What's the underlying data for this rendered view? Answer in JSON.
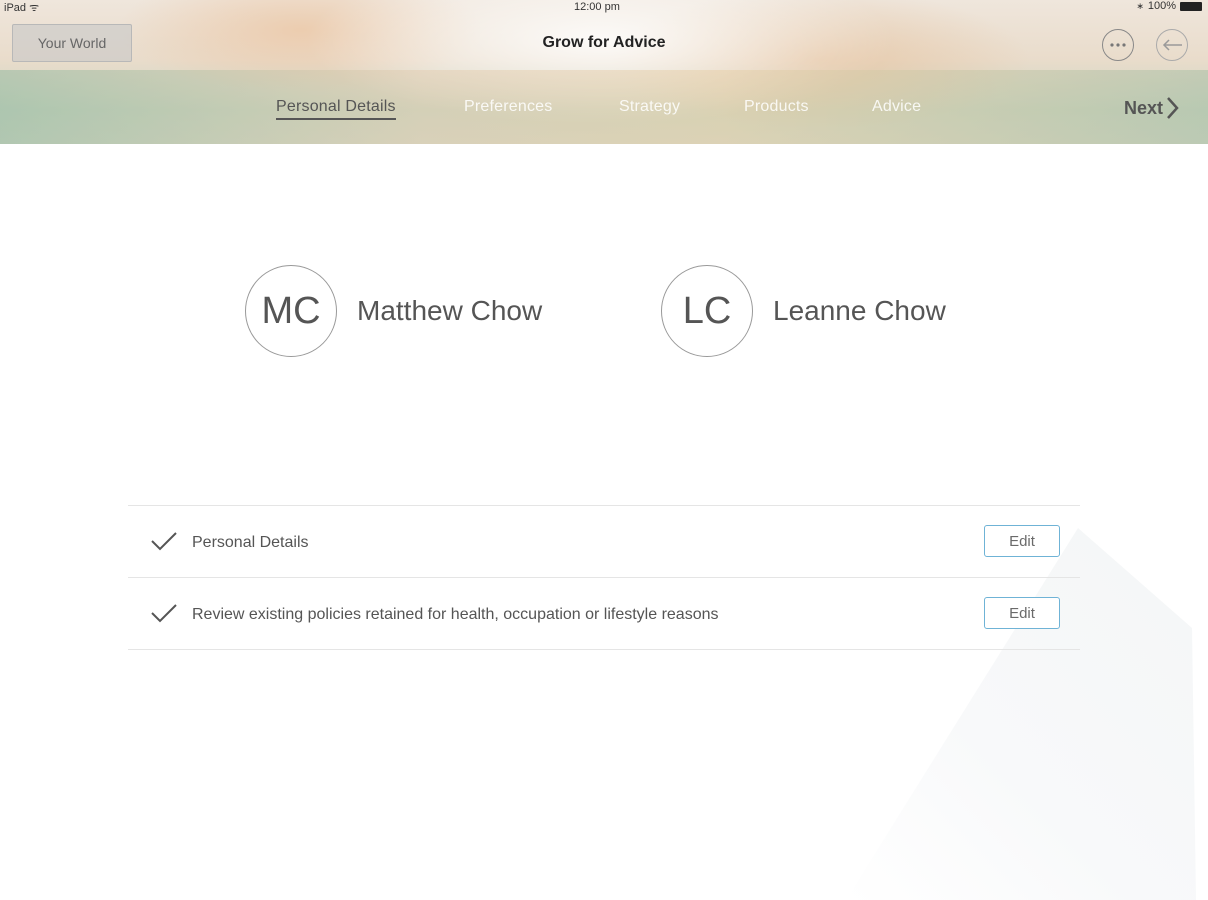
{
  "status_bar": {
    "device": "iPad",
    "time": "12:00 pm",
    "battery": "100%"
  },
  "header": {
    "left_button": "Your World",
    "title": "Grow for Advice",
    "icons": [
      "more-icon",
      "back-arrow-icon"
    ]
  },
  "tabs": [
    {
      "label": "Personal Details",
      "active": true
    },
    {
      "label": "Preferences",
      "active": false
    },
    {
      "label": "Strategy",
      "active": false
    },
    {
      "label": "Products",
      "active": false
    },
    {
      "label": "Advice",
      "active": false
    }
  ],
  "next_label": "Next",
  "people": [
    {
      "initials": "MC",
      "name": "Matthew Chow"
    },
    {
      "initials": "LC",
      "name": "Leanne Chow"
    }
  ],
  "checklist": [
    {
      "label": "Personal Details",
      "button": "Edit",
      "checked": true
    },
    {
      "label": "Review existing policies retained for health, occupation or lifestyle reasons",
      "button": "Edit",
      "checked": true
    }
  ],
  "colors": {
    "edit_border": "#6fb3d6",
    "active_tab": "#555555"
  }
}
